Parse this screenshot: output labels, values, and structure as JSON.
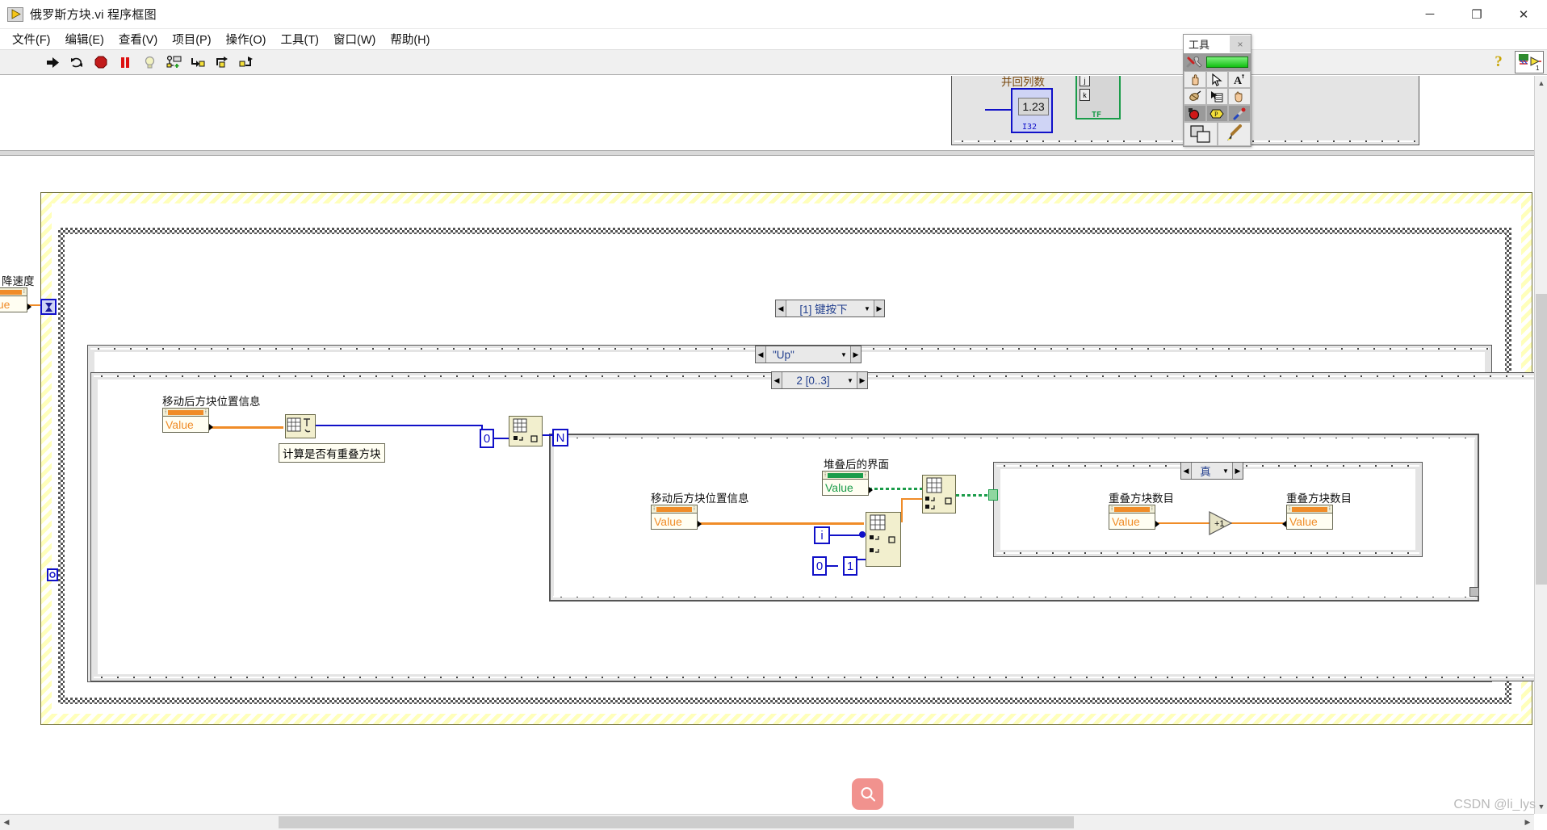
{
  "window": {
    "title": "俄罗斯方块.vi 程序框图",
    "icon": "labview-vi-icon",
    "controls": {
      "minimize": "─",
      "maximize": "❐",
      "close": "✕"
    }
  },
  "menubar": {
    "items": [
      {
        "label": "文件(F)",
        "name": "menu-file"
      },
      {
        "label": "编辑(E)",
        "name": "menu-edit"
      },
      {
        "label": "查看(V)",
        "name": "menu-view"
      },
      {
        "label": "项目(P)",
        "name": "menu-project"
      },
      {
        "label": "操作(O)",
        "name": "menu-operate"
      },
      {
        "label": "工具(T)",
        "name": "menu-tools"
      },
      {
        "label": "窗口(W)",
        "name": "menu-window"
      },
      {
        "label": "帮助(H)",
        "name": "menu-help"
      }
    ]
  },
  "toolbar": {
    "buttons": [
      {
        "name": "run-button",
        "icon": "run-arrow-icon"
      },
      {
        "name": "run-continuously-button",
        "icon": "run-continuous-icon"
      },
      {
        "name": "abort-button",
        "icon": "abort-stop-icon"
      },
      {
        "name": "pause-button",
        "icon": "pause-icon"
      },
      {
        "name": "highlight-execution-button",
        "icon": "lightbulb-icon"
      },
      {
        "name": "retain-wire-values-button",
        "icon": "retain-wire-values-icon"
      },
      {
        "name": "step-into-button",
        "icon": "step-into-icon"
      },
      {
        "name": "step-over-button",
        "icon": "step-over-icon"
      },
      {
        "name": "step-out-button",
        "icon": "step-out-icon"
      }
    ],
    "help_label": "?",
    "help_name": "context-help-button",
    "connector_pane_name": "connector-pane-icon",
    "connector_pane_number": "1"
  },
  "tools_palette": {
    "title": "工具",
    "close_label": "×",
    "automatic_tool_name": "automatic-tool-selection-toggle",
    "tools": [
      {
        "name": "operate-value-tool",
        "icon": "hand-icon"
      },
      {
        "name": "position-size-select-tool",
        "icon": "arrow-cursor-icon"
      },
      {
        "name": "edit-text-tool",
        "icon": "text-A-icon"
      },
      {
        "name": "connect-wire-tool",
        "icon": "wire-spool-icon"
      },
      {
        "name": "object-shortcut-menu-tool",
        "icon": "context-menu-icon"
      },
      {
        "name": "scroll-window-tool",
        "icon": "open-hand-icon"
      },
      {
        "name": "set-clear-breakpoint-tool",
        "icon": "breakpoint-stop-icon"
      },
      {
        "name": "probe-data-tool",
        "icon": "probe-icon"
      },
      {
        "name": "get-set-color-tool",
        "icon": "eyedropper-icon"
      },
      {
        "name": "color-swatch-tool",
        "icon": "color-swatch-icon"
      },
      {
        "name": "paint-brush-tool",
        "icon": "paintbrush-icon"
      }
    ]
  },
  "diagram": {
    "structures": [
      {
        "name": "event-structure-selector",
        "label": "[1] 键按下",
        "left_arrow": "◀",
        "right_arrow": "▶",
        "dropdown": "▼"
      },
      {
        "name": "case-structure-key-selector",
        "label": "\"Up\"",
        "left_arrow": "◀",
        "right_arrow": "▶",
        "dropdown": "▼"
      },
      {
        "name": "case-structure-index-selector",
        "label": "2 [0..3]",
        "left_arrow": "◀",
        "right_arrow": "▶",
        "dropdown": "▼"
      },
      {
        "name": "case-structure-boolean-selector",
        "label": "真",
        "left_arrow": "◀",
        "right_arrow": "▶",
        "dropdown": "▼"
      }
    ],
    "property_nodes": [
      {
        "name": "property-node-drop-speed",
        "label": "降速度",
        "value_text": "alue",
        "accent": "#f08c28"
      },
      {
        "name": "property-node-block-position-1",
        "label": "移动后方块位置信息",
        "value_text": "Value",
        "accent": "#f08c28"
      },
      {
        "name": "property-node-block-position-2",
        "label": "移动后方块位置信息",
        "value_text": "Value",
        "accent": "#f08c28"
      },
      {
        "name": "property-node-stacked-interface",
        "label": "堆叠后的界面",
        "value_text": "Value",
        "accent": "#1b9c4a"
      },
      {
        "name": "property-node-overlap-count-read",
        "label": "重叠方块数目",
        "value_text": "Value",
        "accent": "#f08c28"
      },
      {
        "name": "property-node-overlap-count-write",
        "label": "重叠方块数目",
        "value_text": "Value",
        "accent": "#f08c28"
      }
    ],
    "subvi": {
      "name": "subvi-calc-overlap",
      "label": "计算是否有重叠方块"
    },
    "constants": [
      {
        "name": "constant-zero-array-index",
        "value": "0"
      },
      {
        "name": "constant-zero-row",
        "value": "0"
      },
      {
        "name": "constant-one-col",
        "value": "1"
      },
      {
        "name": "constant-numeric-123",
        "value": "1.23"
      }
    ],
    "terminals": [
      {
        "name": "loop-count-terminal-N",
        "value": "N"
      },
      {
        "name": "loop-iteration-terminal-i",
        "value": "i"
      },
      {
        "name": "index-j-terminal",
        "value": "j"
      },
      {
        "name": "index-k-terminal",
        "value": "k"
      }
    ],
    "labels": [
      {
        "name": "label-array-index-type-i32",
        "value": "I32"
      },
      {
        "name": "label-boolean-type-tf",
        "value": "TF"
      },
      {
        "name": "label-array-count-partial",
        "value": "并回列数"
      }
    ],
    "functions": [
      {
        "name": "function-increment",
        "label": "+1"
      }
    ]
  },
  "overlay": {
    "search_fab_name": "search-fab-button",
    "search_icon": "magnifier-icon",
    "watermark": "CSDN @li_lys"
  },
  "scrollbars": {
    "vertical_name": "vertical-scrollbar",
    "horizontal_name": "horizontal-scrollbar",
    "up_arrow": "▲",
    "down_arrow": "▼",
    "left_arrow": "◀",
    "right_arrow": "▶"
  },
  "colors": {
    "wire_orange": "#f08c28",
    "wire_blue": "#1010c8",
    "wire_green": "#1b9c4a",
    "node_fill": "#f2efce",
    "structure_fill": "#e4e4e4"
  }
}
